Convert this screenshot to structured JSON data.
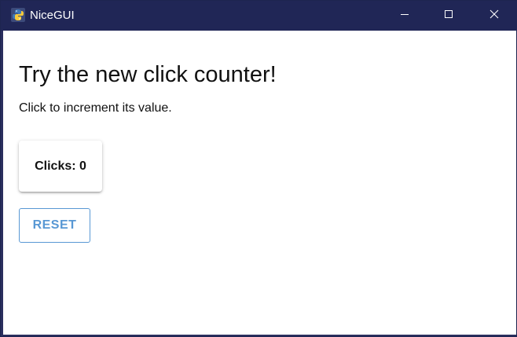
{
  "window": {
    "title": "NiceGUI",
    "controls": {
      "minimize": "minimize",
      "maximize": "maximize",
      "close": "close"
    }
  },
  "page": {
    "heading": "Try the new click counter!",
    "subtext": "Click to increment its value.",
    "counter": {
      "label": "Clicks: 0",
      "value": 0
    },
    "reset_label": "RESET"
  },
  "colors": {
    "titlebar": "#202656",
    "accent": "#5898d4",
    "text": "#111111"
  },
  "icons": {
    "app": "python-icon",
    "minimize": "minimize-icon",
    "maximize": "maximize-icon",
    "close": "close-icon"
  }
}
